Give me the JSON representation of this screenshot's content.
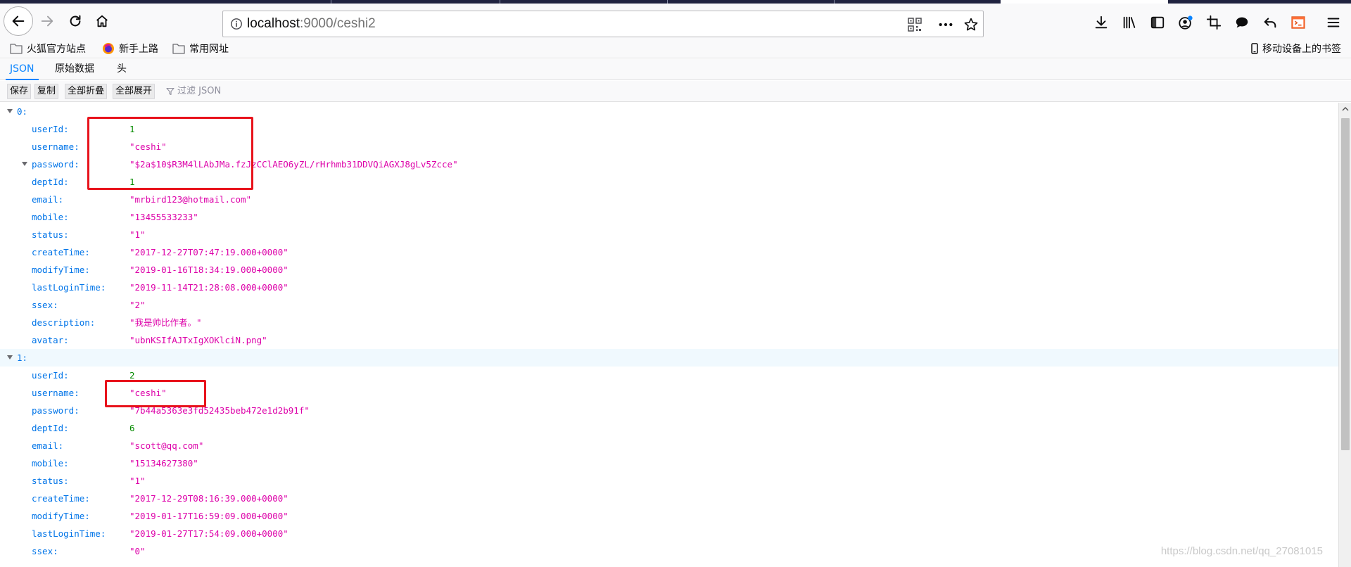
{
  "browser": {
    "url_host": "localhost",
    "url_rest": ":9000/ceshi2",
    "bookmarks": [
      "火狐官方站点",
      "新手上路",
      "常用网址"
    ],
    "mobile_bookmarks": "移动设备上的书签"
  },
  "viewer": {
    "tabs": [
      "JSON",
      "原始数据",
      "头"
    ],
    "toolbar": {
      "save": "保存",
      "copy": "复制",
      "collapse_all": "全部折叠",
      "expand_all": "全部展开",
      "filter_placeholder": "过滤 JSON"
    }
  },
  "records": [
    {
      "index_label": "0:",
      "fields": [
        {
          "key": "userId:",
          "value": "1",
          "kind": "num"
        },
        {
          "key": "username:",
          "value": "\"ceshi\"",
          "kind": "str"
        },
        {
          "key": "password:",
          "value": "\"$2a$10$R3M4lLAbJMa.fzJzCClAEO6yZL/rHrhmb31DDVQiAGXJ8gLv5Zcce\"",
          "kind": "str"
        },
        {
          "key": "deptId:",
          "value": "1",
          "kind": "num"
        },
        {
          "key": "email:",
          "value": "\"mrbird123@hotmail.com\"",
          "kind": "str"
        },
        {
          "key": "mobile:",
          "value": "\"13455533233\"",
          "kind": "str"
        },
        {
          "key": "status:",
          "value": "\"1\"",
          "kind": "str"
        },
        {
          "key": "createTime:",
          "value": "\"2017-12-27T07:47:19.000+0000\"",
          "kind": "str"
        },
        {
          "key": "modifyTime:",
          "value": "\"2019-01-16T18:34:19.000+0000\"",
          "kind": "str"
        },
        {
          "key": "lastLoginTime:",
          "value": "\"2019-11-14T21:28:08.000+0000\"",
          "kind": "str"
        },
        {
          "key": "ssex:",
          "value": "\"2\"",
          "kind": "str"
        },
        {
          "key": "description:",
          "value": "\"我是帅比作者。\"",
          "kind": "str"
        },
        {
          "key": "avatar:",
          "value": "\"ubnKSIfAJTxIgXOKlciN.png\"",
          "kind": "str"
        }
      ]
    },
    {
      "index_label": "1:",
      "fields": [
        {
          "key": "userId:",
          "value": "2",
          "kind": "num"
        },
        {
          "key": "username:",
          "value": "\"ceshi\"",
          "kind": "str"
        },
        {
          "key": "password:",
          "value": "\"7b44a5363e3fd52435beb472e1d2b91f\"",
          "kind": "str"
        },
        {
          "key": "deptId:",
          "value": "6",
          "kind": "num"
        },
        {
          "key": "email:",
          "value": "\"scott@qq.com\"",
          "kind": "str"
        },
        {
          "key": "mobile:",
          "value": "\"15134627380\"",
          "kind": "str"
        },
        {
          "key": "status:",
          "value": "\"1\"",
          "kind": "str"
        },
        {
          "key": "createTime:",
          "value": "\"2017-12-29T08:16:39.000+0000\"",
          "kind": "str"
        },
        {
          "key": "modifyTime:",
          "value": "\"2019-01-17T16:59:09.000+0000\"",
          "kind": "str"
        },
        {
          "key": "lastLoginTime:",
          "value": "\"2019-01-27T17:54:09.000+0000\"",
          "kind": "str"
        },
        {
          "key": "ssex:",
          "value": "\"0\"",
          "kind": "str"
        }
      ]
    }
  ],
  "watermark": "https://blog.csdn.net/qq_27081015",
  "icons": [
    "back-icon",
    "forward-icon",
    "reload-icon",
    "home-icon",
    "info-icon",
    "qr-code-icon",
    "more-icon",
    "star-icon",
    "download-icon",
    "library-icon",
    "sidebar-icon",
    "account-icon",
    "crop-icon",
    "chat-icon",
    "undo-icon",
    "devtools-icon",
    "menu-icon",
    "folder-icon",
    "firefox-icon",
    "mobile-icon",
    "filter-icon"
  ],
  "colors": {
    "accent": "#0a84ff",
    "key": "#0074e8",
    "string": "#dd00a9",
    "number": "#058b00",
    "annotation": "#e8131c"
  }
}
